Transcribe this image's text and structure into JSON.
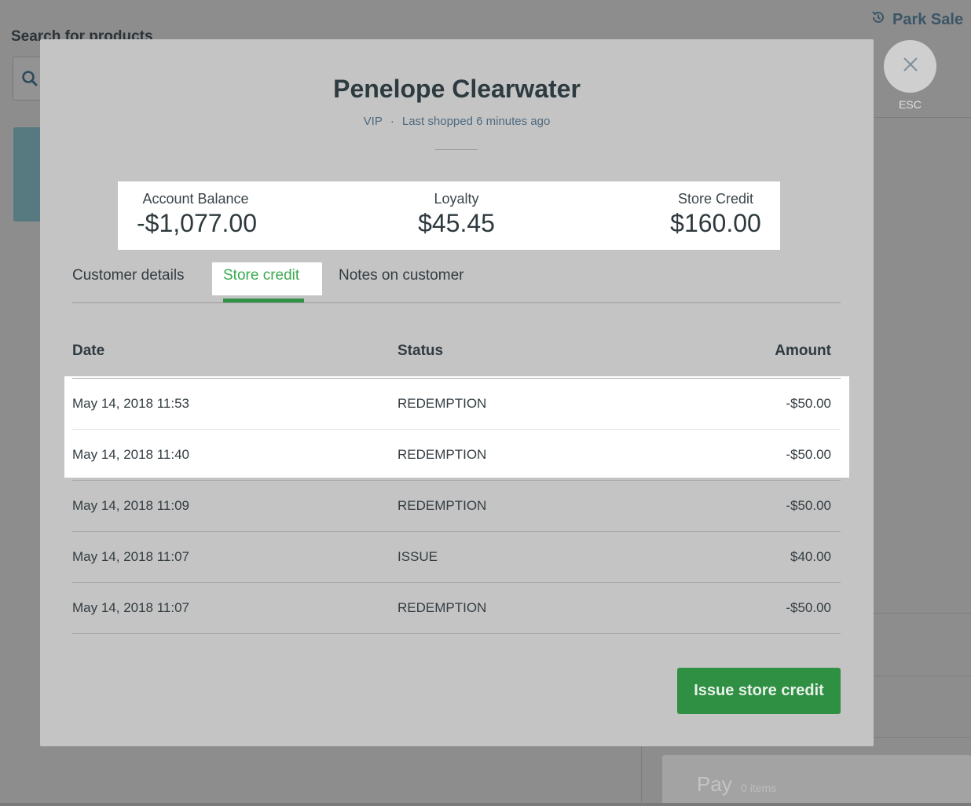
{
  "background": {
    "search_label": "Search for products",
    "park_sale_label": "Park Sale",
    "pay_label": "Pay",
    "pay_items": "0 items"
  },
  "close": {
    "esc_label": "ESC"
  },
  "customer": {
    "name": "Penelope Clearwater",
    "tier": "VIP",
    "separator": "·",
    "last_shopped": "Last shopped 6 minutes ago"
  },
  "stats": {
    "account_balance_label": "Account Balance",
    "account_balance_value": "-$1,077.00",
    "loyalty_label": "Loyalty",
    "loyalty_value": "$45.45",
    "store_credit_label": "Store Credit",
    "store_credit_value": "$160.00"
  },
  "tabs": [
    {
      "label": "Customer details"
    },
    {
      "label": "Store credit"
    },
    {
      "label": "Notes on customer"
    }
  ],
  "table": {
    "headers": {
      "date": "Date",
      "status": "Status",
      "amount": "Amount"
    },
    "rows": [
      {
        "date": "May 14, 2018 11:53",
        "status": "REDEMPTION",
        "amount": "-$50.00"
      },
      {
        "date": "May 14, 2018 11:40",
        "status": "REDEMPTION",
        "amount": "-$50.00"
      },
      {
        "date": "May 14, 2018 11:09",
        "status": "REDEMPTION",
        "amount": "-$50.00"
      },
      {
        "date": "May 14, 2018 11:07",
        "status": "ISSUE",
        "amount": "$40.00"
      },
      {
        "date": "May 14, 2018 11:07",
        "status": "REDEMPTION",
        "amount": "-$50.00"
      }
    ]
  },
  "actions": {
    "issue_store_credit": "Issue store credit"
  },
  "colors": {
    "accent_green": "#2f8f43",
    "active_tab_text": "#3bab4f",
    "overlay": "#8d8d8d",
    "modal_bg": "#c4c4c4"
  }
}
